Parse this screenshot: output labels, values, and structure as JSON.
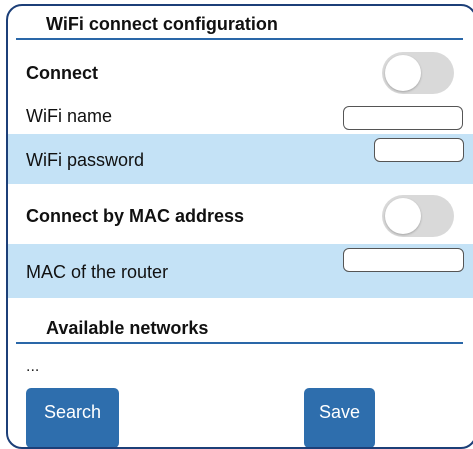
{
  "config_section": {
    "title": "WiFi connect configuration"
  },
  "rows": {
    "connect": {
      "label": "Connect",
      "toggle_on": false
    },
    "wifi_name": {
      "label": "WiFi name",
      "value": ""
    },
    "wifi_password": {
      "label": "WiFi password",
      "value": ""
    },
    "connect_by_mac": {
      "label": "Connect by MAC address",
      "toggle_on": false
    },
    "router_mac": {
      "label": "MAC of the router",
      "value": ""
    }
  },
  "networks_section": {
    "title": "Available networks",
    "list_text": "..."
  },
  "buttons": {
    "search_label": "Search",
    "save_label": "Save"
  },
  "colors": {
    "frame_border": "#1c3f78",
    "header_underline": "#2a67a8",
    "row_highlight": "#c4e2f6",
    "button_bg": "#2e6ead",
    "toggle_off": "#d9d9d9"
  }
}
